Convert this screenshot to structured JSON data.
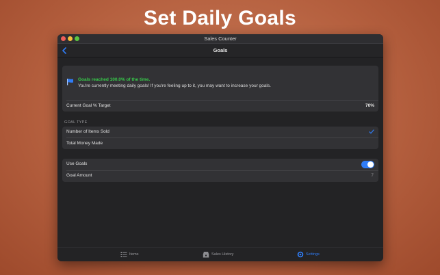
{
  "headline": "Set Daily Goals",
  "window": {
    "title": "Sales Counter"
  },
  "navbar": {
    "title": "Goals"
  },
  "banner": {
    "title": "Goals reached 100.0% of the time.",
    "message": "You're currently meeting daily goals! If you're feeling up to it, you may want to increase your goals.",
    "target_label": "Current Goal % Target",
    "target_value": "70%"
  },
  "goal_type": {
    "header": "GOAL TYPE",
    "options": [
      {
        "label": "Number of Items Sold",
        "selected": true
      },
      {
        "label": "Total Money Made",
        "selected": false
      }
    ]
  },
  "settings": {
    "use_goals_label": "Use Goals",
    "use_goals_enabled": true,
    "goal_amount_label": "Goal Amount",
    "goal_amount_value": "7"
  },
  "tabs": [
    {
      "label": "Items",
      "icon": "list-icon",
      "active": false
    },
    {
      "label": "Sales History",
      "icon": "cash-register-icon",
      "active": false
    },
    {
      "label": "Settings",
      "icon": "gear-icon",
      "active": true
    }
  ],
  "colors": {
    "accent": "#2f7cf6",
    "success": "#37c94a",
    "tab_inactive": "#9a9a9e"
  }
}
